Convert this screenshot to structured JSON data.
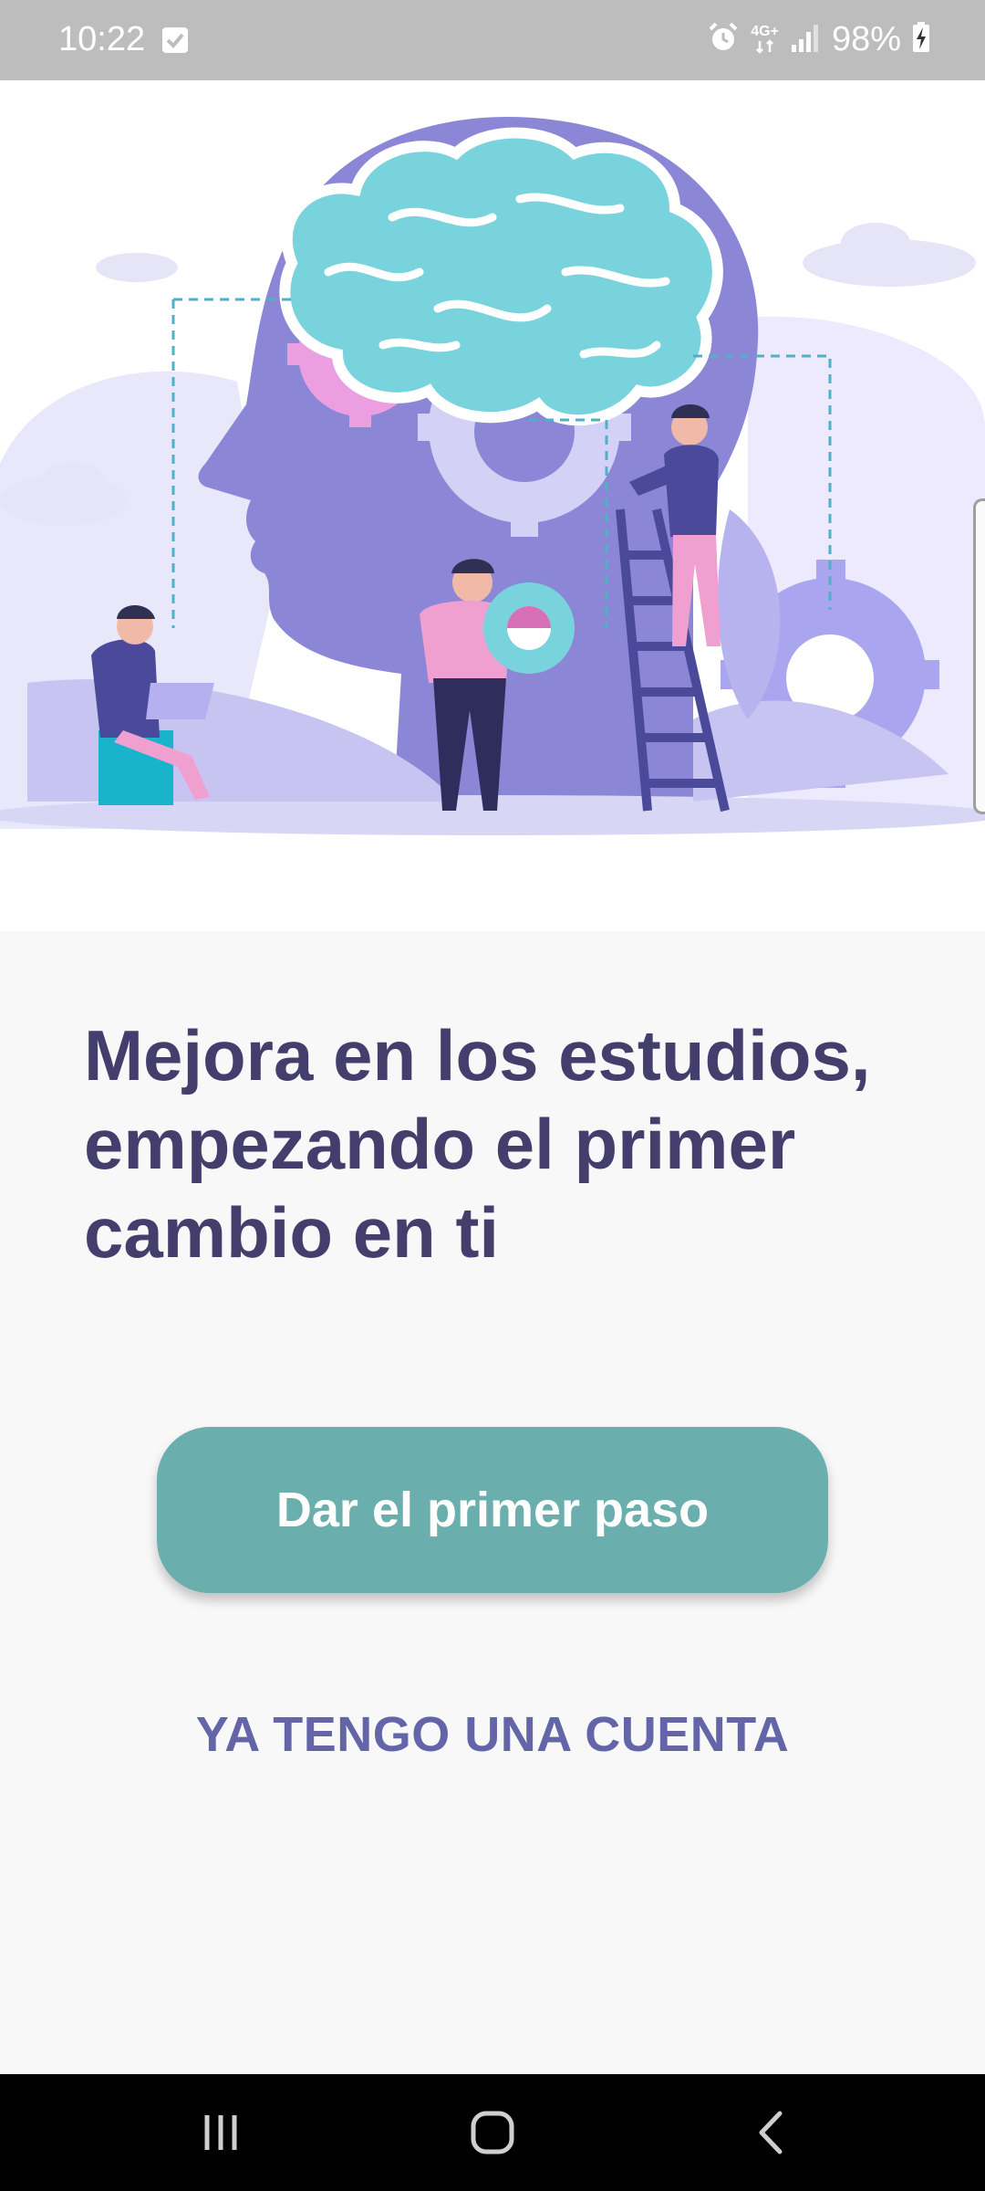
{
  "status_bar": {
    "time": "10:22",
    "network": "4G+",
    "battery": "98%"
  },
  "hero": {
    "illustration": "brain-gears-teamwork-illustration"
  },
  "onboarding": {
    "headline_line1": "Mejora en los estudios,",
    "headline_line2": "empezando el primer",
    "headline_line3": "cambio en ti",
    "primary_button": "Dar el primer paso",
    "secondary_link": "YA TENGO UNA CUENTA"
  },
  "colors": {
    "headline": "#443e6c",
    "primary_button": "#6aafad",
    "secondary_link": "#6465a9",
    "accent_purple": "#8b87d6",
    "accent_cyan": "#79d3dd"
  },
  "nav_bar": {
    "icons": [
      "recents-icon",
      "home-icon",
      "back-icon"
    ]
  }
}
